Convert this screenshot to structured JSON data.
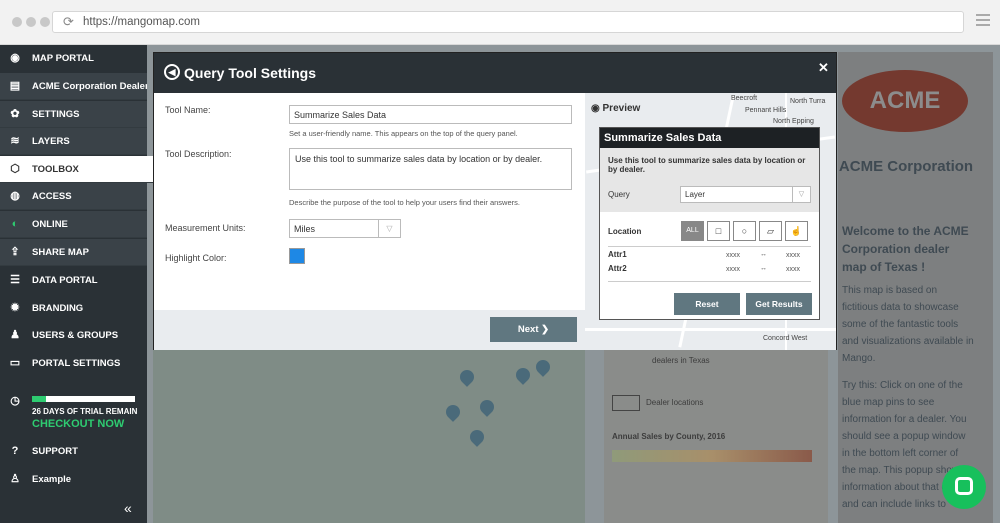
{
  "browser": {
    "url": "https://mangomap.com"
  },
  "sidebar": {
    "items": [
      {
        "label": "MAP PORTAL"
      },
      {
        "label": "ACME Corporation Dealer Map"
      },
      {
        "label": "SETTINGS"
      },
      {
        "label": "LAYERS"
      },
      {
        "label": "TOOLBOX"
      },
      {
        "label": "ACCESS"
      },
      {
        "label": "ONLINE"
      },
      {
        "label": "SHARE MAP"
      },
      {
        "label": "DATA PORTAL"
      },
      {
        "label": "BRANDING"
      },
      {
        "label": "USERS & GROUPS"
      },
      {
        "label": "PORTAL SETTINGS"
      }
    ],
    "trial": {
      "text": "26 DAYS OF TRIAL REMAIN",
      "checkout": "CHECKOUT NOW",
      "progress": 0.14
    },
    "support": "SUPPORT",
    "example": "Example",
    "collapse": "«"
  },
  "dialog": {
    "title": "Query Tool Settings",
    "close": "✕",
    "tool_name_label": "Tool Name:",
    "tool_name_value": "Summarize Sales Data",
    "tool_name_help": "Set a user-friendly name. This appears on the top of the query panel.",
    "tool_desc_label": "Tool Description:",
    "tool_desc_value": "Use this tool to summarize sales data by location or by dealer.",
    "tool_desc_help": "Describe the purpose of the tool to help your users find their answers.",
    "units_label": "Measurement Units:",
    "units_value": "Miles",
    "highlight_label": "Highlight Color:",
    "highlight_color": "#1e88e5",
    "next_label": "Next"
  },
  "preview": {
    "label": "Preview",
    "places": [
      "Beecroft",
      "Pennant Hills",
      "North Epping",
      "North Turra",
      "Concord West"
    ],
    "panel": {
      "title": "Summarize Sales Data",
      "description": "Use this tool to summarize sales data by location or by dealer.",
      "query_label": "Query",
      "query_value": "Layer",
      "location_label": "Location",
      "all_label": "ALL",
      "attr1": "Attr1",
      "attr2": "Attr2",
      "xxxx": "xxxx",
      "arrow": "↔",
      "reset": "Reset",
      "get_results": "Get Results"
    }
  },
  "right_panel": {
    "logo": "ACME",
    "title": "ACME Corporation",
    "welcome": "Welcome to the ACME Corporation dealer map of Texas !",
    "p1": "This map is based on fictitious data to showcase some of the fantastic tools and visualizations available in Mango.",
    "p2": "Try this: Click on one of the blue map pins to see information for a dealer. You should see a popup window in the bottom left corner of the map. This popup shows information about that dealer and can include links to"
  },
  "legend": {
    "dealers": "dealers in Texas",
    "dealer_locations": "Dealer locations",
    "annual_sales": "Annual Sales by County, 2016"
  },
  "colors": {
    "sidebar": "#2a3136",
    "accent": "#2ecc71",
    "button": "#607780"
  }
}
